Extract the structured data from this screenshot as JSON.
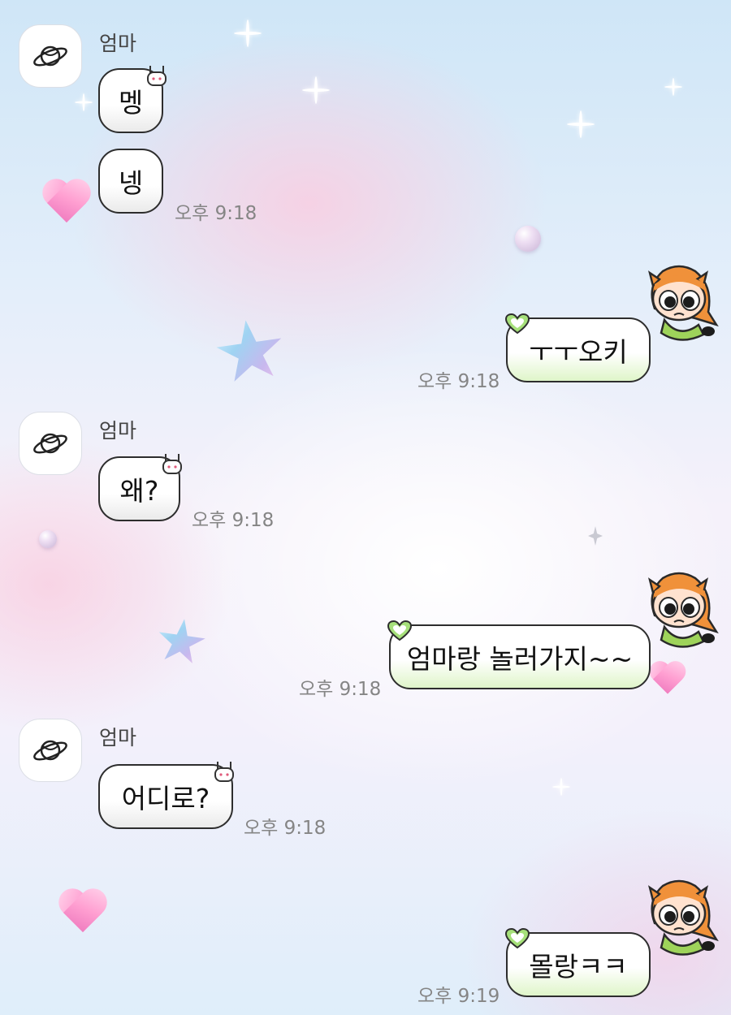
{
  "chat": {
    "messages": [
      {
        "sender": "엄마",
        "text": "멩",
        "direction": "incoming"
      },
      {
        "text": "넹",
        "time": "오후 9:18",
        "direction": "incoming"
      },
      {
        "text": "ㅜㅜ오키",
        "time": "오후 9:18",
        "direction": "outgoing"
      },
      {
        "sender": "엄마",
        "text": "왜?",
        "time": "오후 9:18",
        "direction": "incoming"
      },
      {
        "text": "엄마랑 놀러가지~~",
        "time": "오후 9:18",
        "direction": "outgoing"
      },
      {
        "sender": "엄마",
        "text": "어디로?",
        "time": "오후 9:18",
        "direction": "incoming"
      },
      {
        "text": "몰랑ㅋㅋ",
        "time": "오후 9:19",
        "direction": "outgoing"
      }
    ]
  },
  "icons": {
    "contact_avatar": "planet-icon",
    "bubble_tag_incoming": "bunny-icon",
    "bubble_tag_outgoing": "heart-icon",
    "my_sticker": "cartoon-girl-sticker"
  },
  "colors": {
    "bubble_border": "#2d2d2d",
    "outgoing_tint": "#dff5c9",
    "time_text": "#858585"
  }
}
